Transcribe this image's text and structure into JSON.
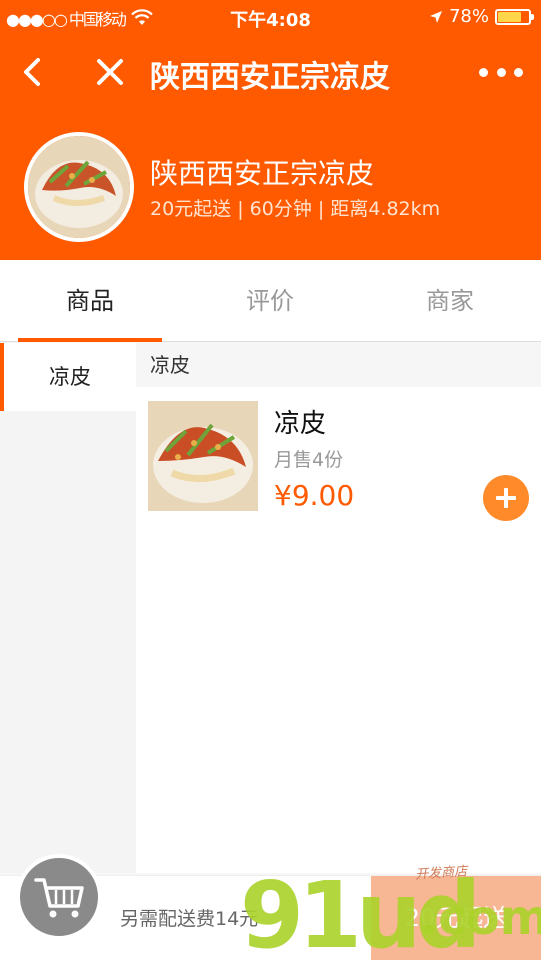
{
  "status_bar": {
    "carrier": "●●●○○ 中国移动",
    "wifi_icon": "wifi-icon",
    "time": "下午4:08",
    "location_icon": "location-arrow-icon",
    "battery_percent": "78%",
    "battery_level": 0.78
  },
  "nav": {
    "title": "陕西西安正宗凉皮",
    "back_icon": "chevron-left-icon",
    "close_icon": "close-icon",
    "more_icon": "more-dots-icon"
  },
  "shop": {
    "name": "陕西西安正宗凉皮",
    "meta": "20元起送 | 60分钟 | 距离4.82km"
  },
  "tabs": [
    {
      "label": "商品"
    },
    {
      "label": "评价"
    },
    {
      "label": "商家"
    }
  ],
  "sidebar": {
    "items": [
      {
        "label": "凉皮"
      }
    ]
  },
  "main": {
    "category_title": "凉皮",
    "products": [
      {
        "name": "凉皮",
        "sales": "月售4份",
        "price": "¥9.00"
      }
    ]
  },
  "bottom": {
    "cart_icon": "shopping-cart-icon",
    "delivery_note": "另需配送费14元",
    "min_order": "20元起送"
  },
  "watermark": {
    "text": "91ud",
    "sub": ".com",
    "note": "开发商店"
  },
  "colors": {
    "brand": "#ff5a00",
    "accent_button": "#ff8a2a",
    "disabled_button": "#f7b694"
  }
}
